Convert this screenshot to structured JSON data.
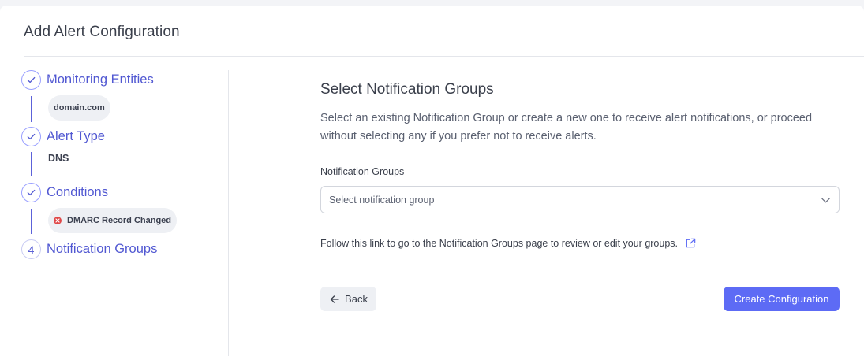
{
  "header": {
    "title": "Add Alert Configuration"
  },
  "stepper": {
    "steps": [
      {
        "label": "Monitoring Entities",
        "state": "completed",
        "value": "domain.com"
      },
      {
        "label": "Alert Type",
        "state": "completed",
        "value": "DNS"
      },
      {
        "label": "Conditions",
        "state": "completed",
        "value": "DMARC Record Changed"
      },
      {
        "label": "Notification Groups",
        "state": "current",
        "number": "4"
      }
    ]
  },
  "main": {
    "title": "Select Notification Groups",
    "description": "Select an existing Notification Group or create a new one to receive alert notifications, or proceed without selecting any if you prefer not to receive alerts.",
    "field_label": "Notification Groups",
    "select_placeholder": "Select notification group",
    "link_text": "Follow this link to go to the Notification Groups page to review or edit your groups.",
    "back_label": "Back",
    "create_label": "Create Configuration"
  },
  "colors": {
    "accent": "#5d6bf5",
    "stepper": "#5158d2",
    "error": "#e04848"
  }
}
